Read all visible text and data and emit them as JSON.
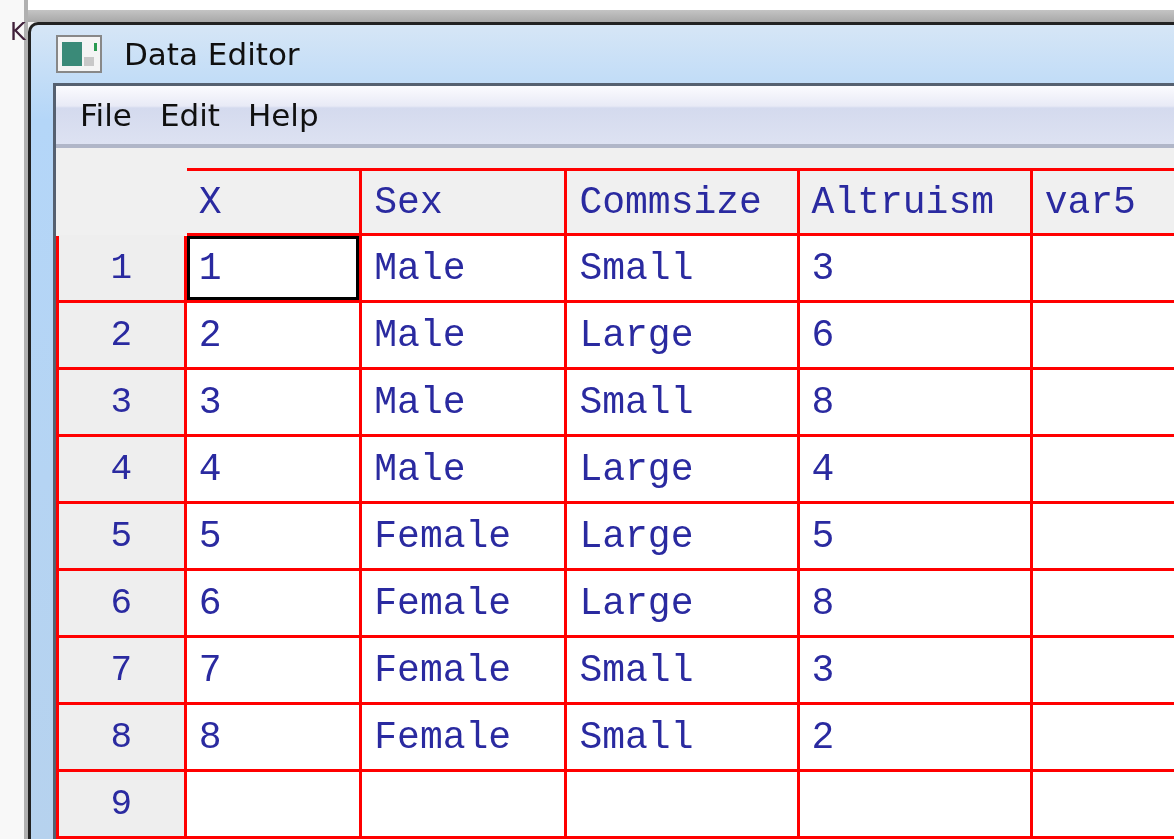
{
  "background_text": "K",
  "window": {
    "title": "Data Editor"
  },
  "menu": [
    "File",
    "Edit",
    "Help"
  ],
  "table": {
    "columns": [
      "X",
      "Sex",
      "Commsize",
      "Altruism",
      "var5"
    ],
    "rows": [
      {
        "label": "1",
        "cells": [
          {
            "value": "1",
            "selected": true
          },
          {
            "value": "Male",
            "selected": false
          },
          {
            "value": "Small",
            "selected": false
          },
          {
            "value": "3",
            "selected": false
          }
        ]
      },
      {
        "label": "2",
        "cells": [
          {
            "value": "2",
            "selected": false
          },
          {
            "value": "Male",
            "selected": false
          },
          {
            "value": "Large",
            "selected": false
          },
          {
            "value": "6",
            "selected": false
          }
        ]
      },
      {
        "label": "3",
        "cells": [
          {
            "value": "3",
            "selected": false
          },
          {
            "value": "Male",
            "selected": false
          },
          {
            "value": "Small",
            "selected": false
          },
          {
            "value": "8",
            "selected": false
          }
        ]
      },
      {
        "label": "4",
        "cells": [
          {
            "value": "4",
            "selected": false
          },
          {
            "value": "Male",
            "selected": false
          },
          {
            "value": "Large",
            "selected": false
          },
          {
            "value": "4",
            "selected": false
          }
        ]
      },
      {
        "label": "5",
        "cells": [
          {
            "value": "5",
            "selected": false
          },
          {
            "value": "Female",
            "selected": false
          },
          {
            "value": "Large",
            "selected": false
          },
          {
            "value": "5",
            "selected": false
          }
        ]
      },
      {
        "label": "6",
        "cells": [
          {
            "value": "6",
            "selected": false
          },
          {
            "value": "Female",
            "selected": false
          },
          {
            "value": "Large",
            "selected": false
          },
          {
            "value": "8",
            "selected": false
          }
        ]
      },
      {
        "label": "7",
        "cells": [
          {
            "value": "7",
            "selected": false
          },
          {
            "value": "Female",
            "selected": false
          },
          {
            "value": "Small",
            "selected": false
          },
          {
            "value": "3",
            "selected": false
          }
        ]
      },
      {
        "label": "8",
        "cells": [
          {
            "value": "8",
            "selected": false
          },
          {
            "value": "Female",
            "selected": false
          },
          {
            "value": "Small",
            "selected": false
          },
          {
            "value": "2",
            "selected": false
          }
        ]
      },
      {
        "label": "9",
        "cells": []
      }
    ]
  }
}
